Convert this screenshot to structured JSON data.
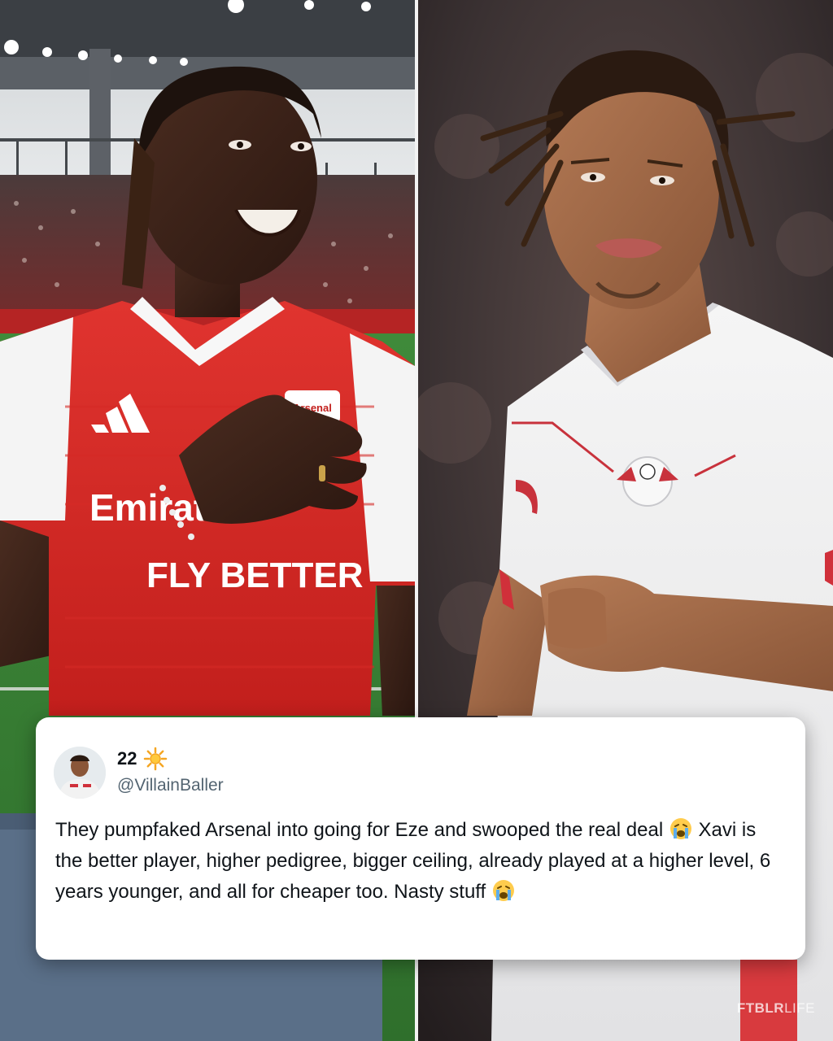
{
  "left_photo": {
    "shirt_text_line1": "Emirates",
    "shirt_text_line2": "FLY BETTER",
    "crest_text": "Arsenal"
  },
  "tweet": {
    "display_name": "22",
    "name_emoji": "sun-icon",
    "handle": "@VillainBaller",
    "text_part1": "They pumpfaked Arsenal into going for Eze and swooped the real deal",
    "text_part2": "Xavi is the better player, higher pedigree, bigger ceiling, already played at a higher level, 6 years younger, and all for cheaper too. Nasty stuff",
    "emoji": "loudly-crying-face"
  },
  "watermark": {
    "brand": "FTBLR",
    "suffix": "LIFE"
  }
}
